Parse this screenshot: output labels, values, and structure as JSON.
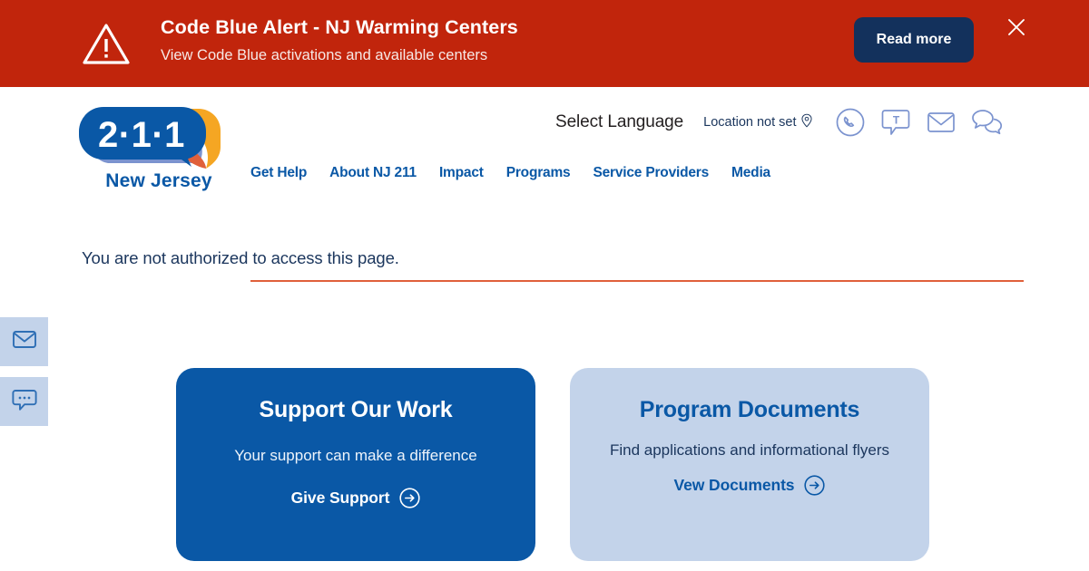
{
  "alert": {
    "icon": "warning-triangle-icon",
    "title": "Code Blue Alert - NJ Warming Centers",
    "subtitle": "View Code Blue activations and available centers",
    "button_label": "Read more",
    "close_icon": "close-icon",
    "background_color": "#c1250c",
    "button_color": "#13315c"
  },
  "header": {
    "logo": {
      "digits": "2·1·1",
      "state": "New Jersey",
      "bubble_color": "#0a58a6",
      "accent_color": "#f5a623",
      "accent_color_2": "#e0603a",
      "shadow_color": "#7b93cf"
    },
    "select_language": "Select Language",
    "location": {
      "label": "Location not set",
      "icon": "location-pin-icon"
    },
    "util_icons": [
      {
        "name": "phone-circle-icon"
      },
      {
        "name": "text-bubble-icon"
      },
      {
        "name": "email-envelope-icon"
      },
      {
        "name": "chat-bubbles-icon"
      }
    ],
    "nav": [
      {
        "label": "Get Help"
      },
      {
        "label": "About NJ 211"
      },
      {
        "label": "Impact"
      },
      {
        "label": "Programs"
      },
      {
        "label": "Service Providers"
      },
      {
        "label": "Media"
      }
    ],
    "nav_rule_color": "#e0603a",
    "nav_link_color": "#0a58a6"
  },
  "main": {
    "message": "You are not authorized to access this page."
  },
  "side_tabs": [
    {
      "name": "email-tab",
      "icon": "envelope-icon"
    },
    {
      "name": "chat-tab",
      "icon": "chat-bubble-dots-icon"
    }
  ],
  "cards": [
    {
      "title": "Support Our Work",
      "subtitle": "Your support can make a difference",
      "cta": "Give Support",
      "cta_icon": "arrow-right-circle-icon",
      "background_color": "#0a58a6"
    },
    {
      "title": "Program Documents",
      "subtitle": "Find applications and informational flyers",
      "cta": "Vew Documents",
      "cta_icon": "arrow-right-circle-icon",
      "background_color": "#c3d3ea"
    }
  ]
}
